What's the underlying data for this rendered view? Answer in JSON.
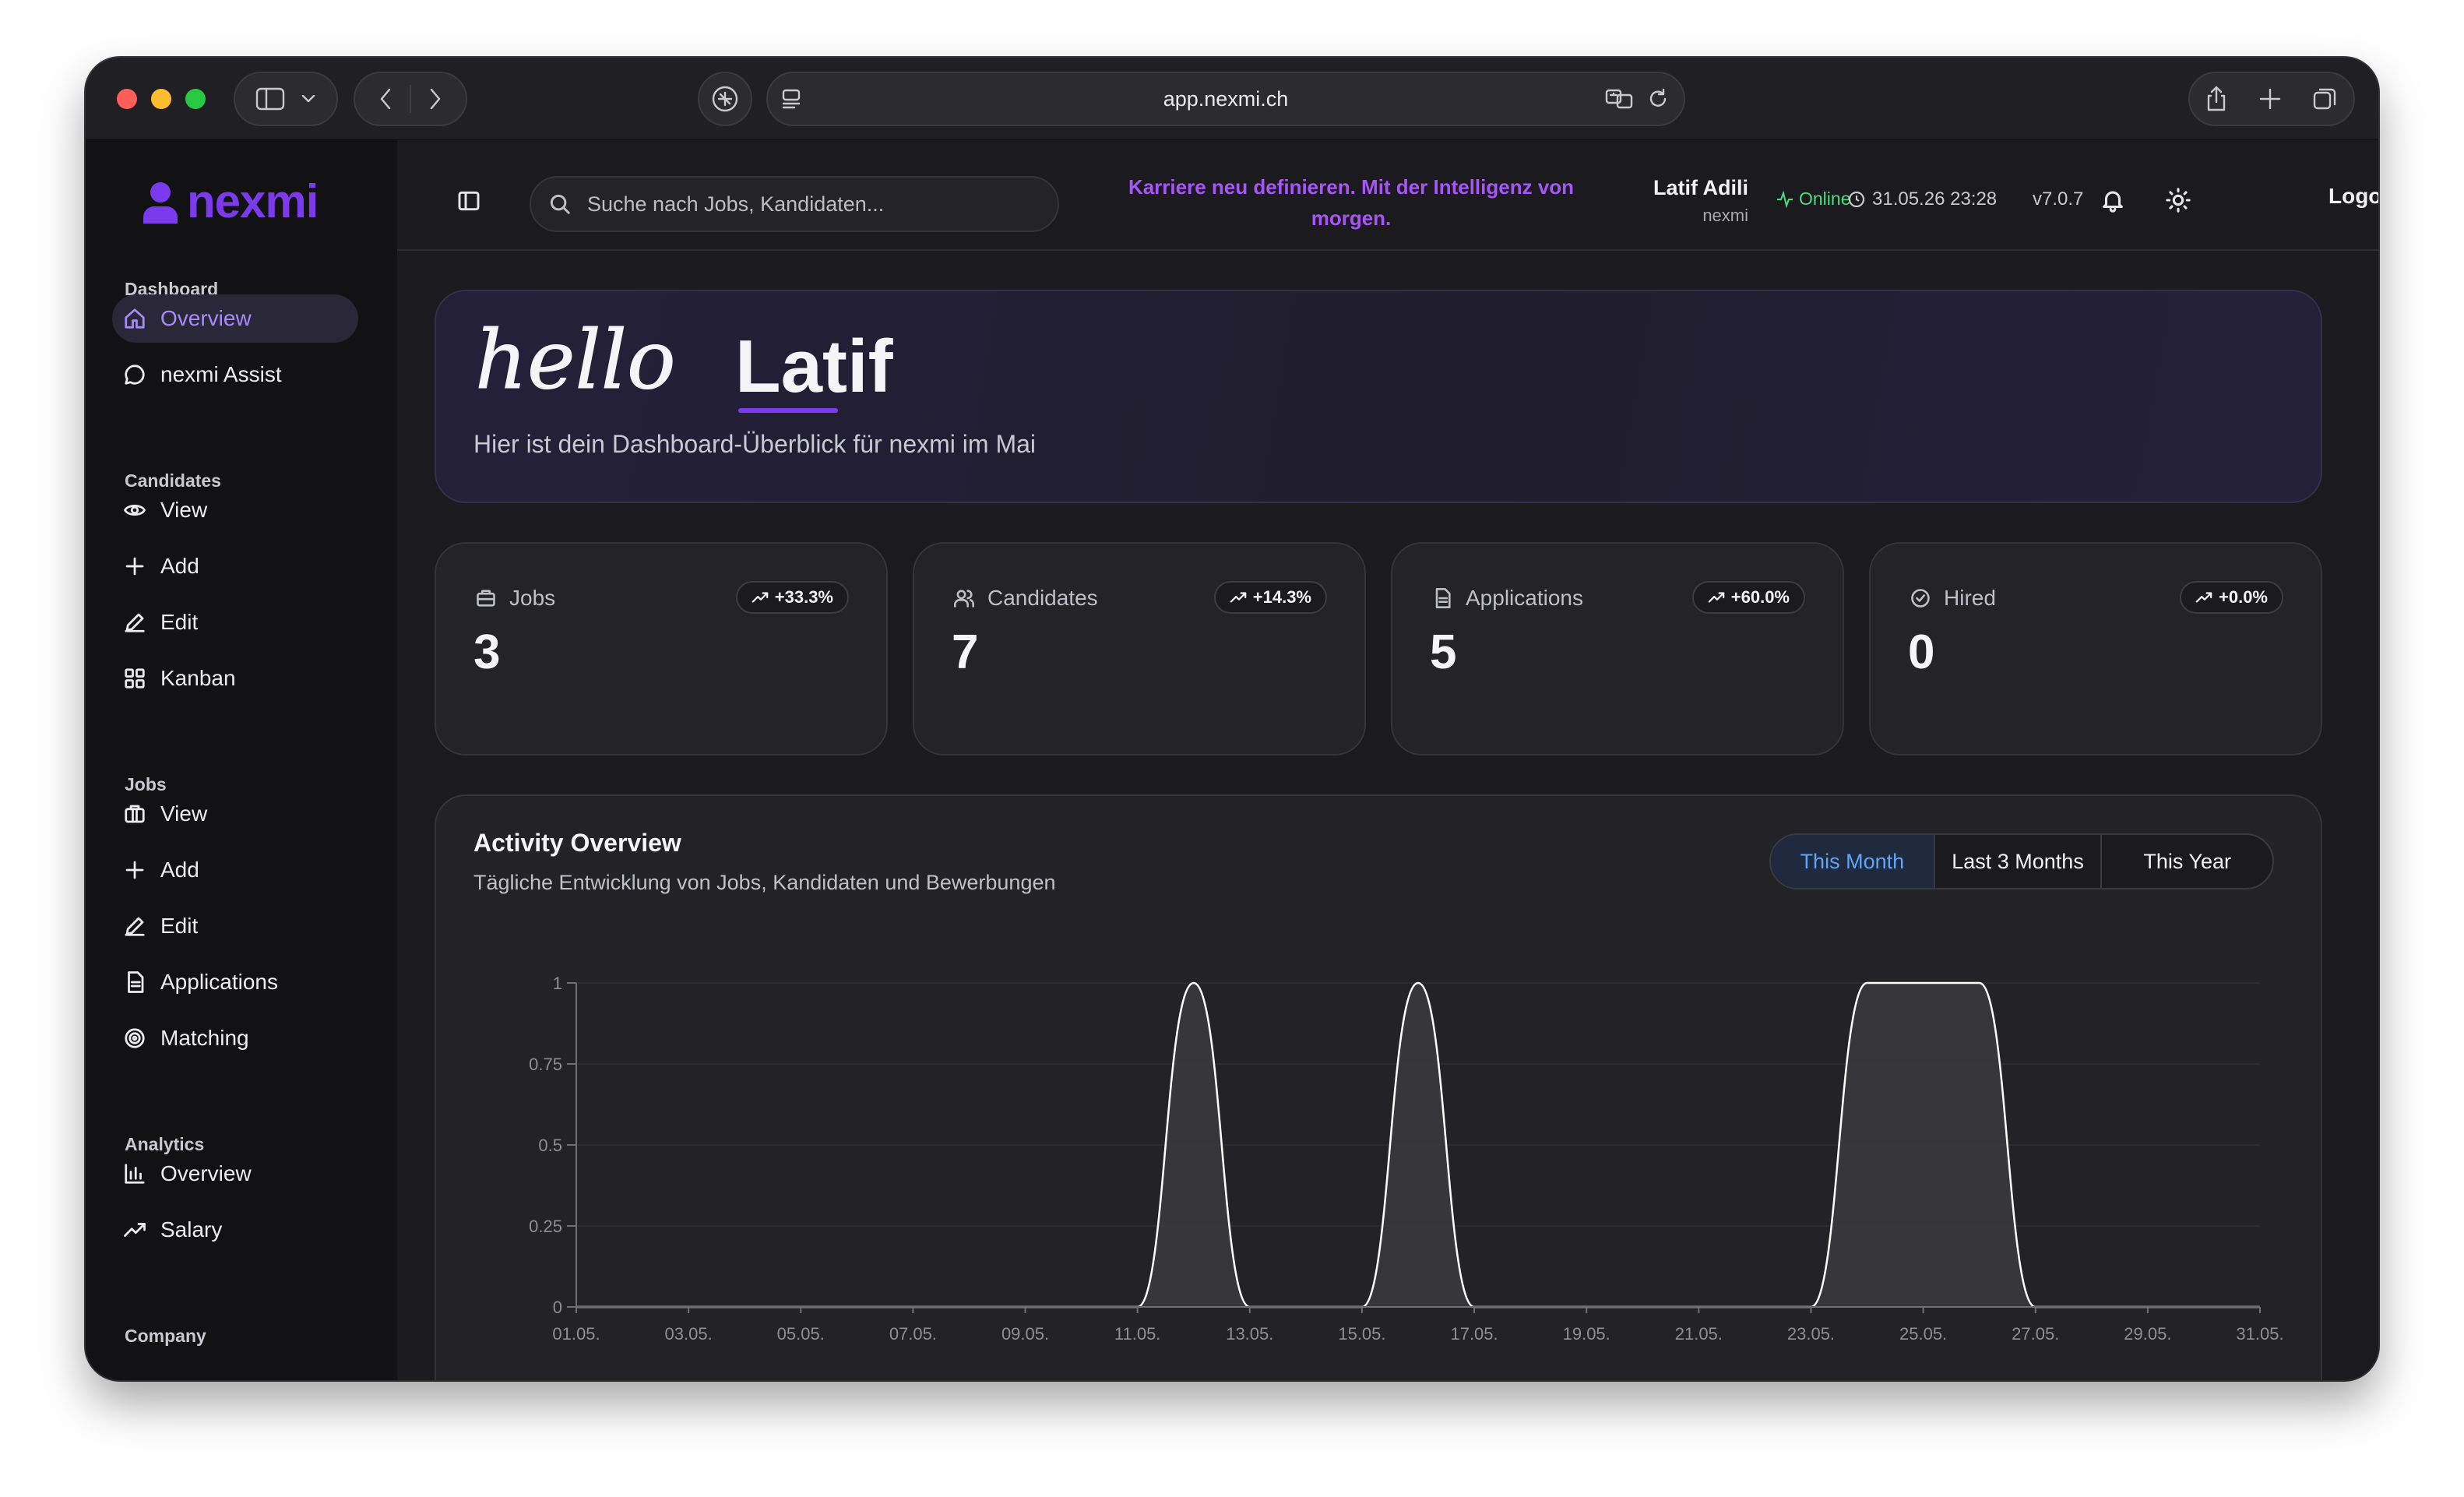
{
  "browser": {
    "url": "app.nexmi.ch"
  },
  "brand": {
    "name": "nexmi",
    "accent": "#7c3aed"
  },
  "sidebar": {
    "sections": [
      {
        "title": "Dashboard",
        "items": [
          {
            "label": "Overview",
            "icon": "home-icon",
            "active": true
          },
          {
            "label": "nexmi Assist",
            "icon": "chat-bubble-icon"
          }
        ]
      },
      {
        "title": "Candidates",
        "items": [
          {
            "label": "View",
            "icon": "eye-icon"
          },
          {
            "label": "Add",
            "icon": "plus-icon"
          },
          {
            "label": "Edit",
            "icon": "pen-icon"
          },
          {
            "label": "Kanban",
            "icon": "kanban-grid-icon"
          }
        ]
      },
      {
        "title": "Jobs",
        "items": [
          {
            "label": "View",
            "icon": "briefcase-icon"
          },
          {
            "label": "Add",
            "icon": "plus-icon"
          },
          {
            "label": "Edit",
            "icon": "pen-icon"
          },
          {
            "label": "Applications",
            "icon": "document-icon"
          },
          {
            "label": "Matching",
            "icon": "target-icon"
          }
        ]
      },
      {
        "title": "Analytics",
        "items": [
          {
            "label": "Overview",
            "icon": "bar-chart-icon"
          },
          {
            "label": "Salary",
            "icon": "trending-up-icon"
          }
        ]
      },
      {
        "title": "Company",
        "items": []
      }
    ]
  },
  "topbar": {
    "search_placeholder": "Suche nach Jobs, Kandidaten...",
    "slogan": "Karriere neu definieren. Mit der Intelligenz von morgen.",
    "user_name": "Latif Adili",
    "user_org": "nexmi",
    "status": "Online",
    "datetime": "31.05.26 23:28",
    "version": "v7.0.7",
    "logout": "Logout",
    "status_color": "#4ade80"
  },
  "hero": {
    "greeting": "hello",
    "name": "Latif",
    "subtitle": "Hier ist dein Dashboard-Überblick für nexmi im Mai"
  },
  "stats": [
    {
      "label": "Jobs",
      "value": "3",
      "change": "+33.3%",
      "icon": "briefcase-icon"
    },
    {
      "label": "Candidates",
      "value": "7",
      "change": "+14.3%",
      "icon": "users-icon"
    },
    {
      "label": "Applications",
      "value": "5",
      "change": "+60.0%",
      "icon": "document-icon"
    },
    {
      "label": "Hired",
      "value": "0",
      "change": "+0.0%",
      "icon": "check-circle-icon"
    }
  ],
  "activity": {
    "title": "Activity Overview",
    "subtitle": "Tägliche Entwicklung von Jobs, Kandidaten und Bewerbungen",
    "ranges": [
      "This Month",
      "Last 3 Months",
      "This Year"
    ],
    "active_range": "This Month"
  },
  "chart_data": {
    "type": "area",
    "x_tick_labels": [
      "01.05.",
      "03.05.",
      "05.05.",
      "07.05.",
      "09.05.",
      "11.05.",
      "13.05.",
      "15.05.",
      "17.05.",
      "19.05.",
      "21.05.",
      "23.05.",
      "25.05.",
      "27.05.",
      "29.05.",
      "31.05."
    ],
    "y_ticks": [
      0,
      0.25,
      0.5,
      0.75,
      1
    ],
    "ylim": [
      0,
      1
    ],
    "x": [
      "01.05.",
      "02.05.",
      "03.05.",
      "04.05.",
      "05.05.",
      "06.05.",
      "07.05.",
      "08.05.",
      "09.05.",
      "10.05.",
      "11.05.",
      "12.05.",
      "13.05.",
      "14.05.",
      "15.05.",
      "16.05.",
      "17.05.",
      "18.05.",
      "19.05.",
      "20.05.",
      "21.05.",
      "22.05.",
      "23.05.",
      "24.05.",
      "25.05.",
      "26.05.",
      "27.05.",
      "28.05.",
      "29.05.",
      "30.05.",
      "31.05."
    ],
    "values": [
      0,
      0,
      0,
      0,
      0,
      0,
      0,
      0,
      0,
      0,
      0,
      1,
      0,
      0,
      0,
      1,
      0,
      0,
      0,
      0,
      0,
      0,
      0,
      1,
      1,
      1,
      0,
      0,
      0,
      0,
      0
    ],
    "grid": true,
    "fill_color": "#3a3a40",
    "stroke_color": "#ffffff"
  }
}
